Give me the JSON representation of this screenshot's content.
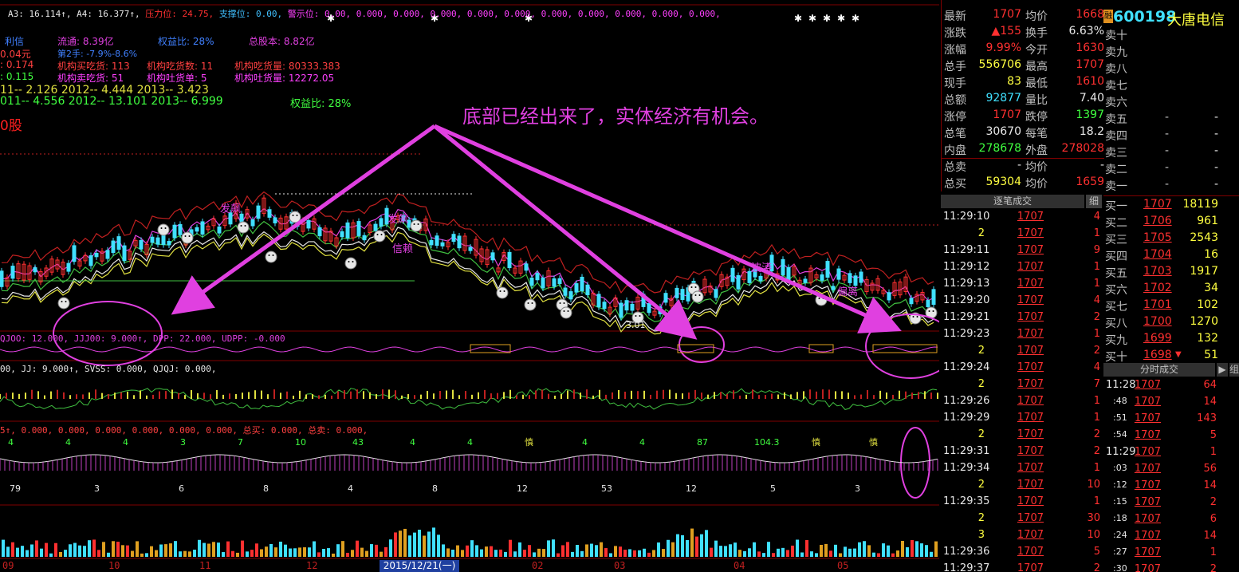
{
  "indicator_line": {
    "a3": "A3: 16.114↑, A4: 16.377↑,",
    "pressure": "压力位: 24.75,",
    "support": "支撑位: 0.00,",
    "warning": "警示位: 0.00, 0.000, 0.000, 0.000, 0.000, 0.000, 0.000, 0.000, 0.000, 0.000, 0.000,"
  },
  "fundamentals": {
    "row1": {
      "a": "利信",
      "b": "流通: 8.39亿",
      "c": "权益比: 28%",
      "d": "总股本: 8.82亿"
    },
    "row2": {
      "a": "0.04元",
      "b": "第2手: -7.9%-8.6%"
    },
    "row3": {
      "a": ": 0.174",
      "b": "机构买吃货: 113",
      "c": "机构吃货数: 11",
      "d": "机构吃货量: 80333.383"
    },
    "row4": {
      "a": ": 0.115",
      "b": "机构卖吃货: 51",
      "c": "机构吐货单: 5",
      "d": "机构吐货量: 12272.05"
    },
    "row5": "11-- 2.126   2012-- 4.444   2013-- 3.423",
    "row6": {
      "a": "011-- 4.556   2012-- 13.101   2013-- 6.999",
      "b": "权益比: 28%"
    },
    "row7": "0股"
  },
  "annotation": "底部已经出来了，实体经济有机会。",
  "candles_labels": {
    "l1": "发飙",
    "l2": "发飙",
    "l3": "信赖",
    "l4": "波涛",
    "l5": "偏离",
    "l6": "3.01"
  },
  "sub1_label": "QJOO: 12.000, JJJ00: 9.000↑, DPP: 22.000, UDPP: -0.000",
  "sub2_label": "00, JJ: 9.000↑, SVSS: 0.000, QJQJ: 0.000,",
  "sub3_label": "5↑, 0.000, 0.000, 0.000, 0.000, 0.000, 0.000, 总买: 0.000, 总卖: 0.000,",
  "sub3_marks": [
    "4",
    "4",
    "4",
    "3",
    "7",
    "10",
    "43",
    "4",
    "4",
    "慎",
    "4",
    "4",
    "87",
    "104.3",
    "慎",
    "慎"
  ],
  "sub3_bottom": [
    "79",
    "3",
    "6",
    "8",
    "4",
    "8",
    "12",
    "53",
    "12",
    "5",
    "3"
  ],
  "xaxis": {
    "labels": [
      "09",
      "10",
      "11",
      "12",
      "02",
      "03",
      "04",
      "05"
    ],
    "highlight_date": "2015/12/21(一)"
  },
  "quote": {
    "rows": [
      {
        "l1": "最新",
        "v1": "1707",
        "c1": "red",
        "l2": "均价",
        "v2": "1668",
        "c2": "red"
      },
      {
        "l1": "涨跌",
        "v1": "▲155",
        "c1": "red",
        "l2": "换手",
        "v2": "6.63%",
        "c2": "white"
      },
      {
        "l1": "涨幅",
        "v1": "9.99%",
        "c1": "red",
        "l2": "今开",
        "v2": "1630",
        "c2": "red"
      },
      {
        "l1": "总手",
        "v1": "556706",
        "c1": "yellow",
        "l2": "最高",
        "v2": "1707",
        "c2": "red"
      },
      {
        "l1": "现手",
        "v1": "83",
        "c1": "yellow",
        "l2": "最低",
        "v2": "1610",
        "c2": "red"
      },
      {
        "l1": "总额",
        "v1": "92877",
        "c1": "cyan",
        "l2": "量比",
        "v2": "7.40",
        "c2": "white"
      },
      {
        "l1": "涨停",
        "v1": "1707",
        "c1": "red",
        "l2": "跌停",
        "v2": "1397",
        "c2": "green"
      },
      {
        "l1": "总笔",
        "v1": "30670",
        "c1": "white",
        "l2": "每笔",
        "v2": "18.2",
        "c2": "white"
      },
      {
        "l1": "内盘",
        "v1": "278678",
        "c1": "green",
        "l2": "外盘",
        "v2": "278028",
        "c2": "red"
      },
      {
        "l1": "总卖",
        "v1": "-",
        "c1": "white",
        "l2": "均价",
        "v2": "-",
        "c2": "white"
      },
      {
        "l1": "总买",
        "v1": "59304",
        "c1": "yellow",
        "l2": "均价",
        "v2": "1659",
        "c2": "red"
      }
    ]
  },
  "stock": {
    "code": "600198",
    "name": "大唐电信",
    "badge": "融"
  },
  "order_book": {
    "sell": [
      {
        "label": "卖十",
        "price": "",
        "vol": ""
      },
      {
        "label": "卖九",
        "price": "",
        "vol": ""
      },
      {
        "label": "卖八",
        "price": "",
        "vol": ""
      },
      {
        "label": "卖七",
        "price": "",
        "vol": ""
      },
      {
        "label": "卖六",
        "price": "",
        "vol": ""
      },
      {
        "label": "卖五",
        "price": "-",
        "vol": "-"
      },
      {
        "label": "卖四",
        "price": "-",
        "vol": "-"
      },
      {
        "label": "卖三",
        "price": "-",
        "vol": "-"
      },
      {
        "label": "卖二",
        "price": "-",
        "vol": "-"
      },
      {
        "label": "卖一",
        "price": "-",
        "vol": "-"
      }
    ],
    "buy": [
      {
        "label": "买一",
        "price": "1707",
        "vol": "18119"
      },
      {
        "label": "买二",
        "price": "1706",
        "vol": "961"
      },
      {
        "label": "买三",
        "price": "1705",
        "vol": "2543"
      },
      {
        "label": "买四",
        "price": "1704",
        "vol": "16"
      },
      {
        "label": "买五",
        "price": "1703",
        "vol": "1917"
      },
      {
        "label": "买六",
        "price": "1702",
        "vol": "34"
      },
      {
        "label": "买七",
        "price": "1701",
        "vol": "102"
      },
      {
        "label": "买八",
        "price": "1700",
        "vol": "1270"
      },
      {
        "label": "买九",
        "price": "1699",
        "vol": "132"
      },
      {
        "label": "买十",
        "price": "1698",
        "vol": "51"
      }
    ]
  },
  "tick_panel": {
    "title": "逐笔成交",
    "corner": "细",
    "rows": [
      {
        "time": "11:29:10",
        "price": "1707",
        "vol": "4"
      },
      {
        "time": "2",
        "price": "1707",
        "vol": "1"
      },
      {
        "time": "11:29:11",
        "price": "1707",
        "vol": "9"
      },
      {
        "time": "11:29:12",
        "price": "1707",
        "vol": "1"
      },
      {
        "time": "11:29:13",
        "price": "1707",
        "vol": "1"
      },
      {
        "time": "11:29:20",
        "price": "1707",
        "vol": "4"
      },
      {
        "time": "11:29:21",
        "price": "1707",
        "vol": "2"
      },
      {
        "time": "11:29:23",
        "price": "1707",
        "vol": "1"
      },
      {
        "time": "2",
        "price": "1707",
        "vol": "2"
      },
      {
        "time": "11:29:24",
        "price": "1707",
        "vol": "4"
      },
      {
        "time": "2",
        "price": "1707",
        "vol": "7"
      },
      {
        "time": "11:29:26",
        "price": "1707",
        "vol": "1"
      },
      {
        "time": "11:29:29",
        "price": "1707",
        "vol": "1"
      },
      {
        "time": "2",
        "price": "1707",
        "vol": "2"
      },
      {
        "time": "11:29:31",
        "price": "1707",
        "vol": "2"
      },
      {
        "time": "11:29:34",
        "price": "1707",
        "vol": "1"
      },
      {
        "time": "2",
        "price": "1707",
        "vol": "10"
      },
      {
        "time": "11:29:35",
        "price": "1707",
        "vol": "1"
      },
      {
        "time": "2",
        "price": "1707",
        "vol": "30"
      },
      {
        "time": "3",
        "price": "1707",
        "vol": "10"
      },
      {
        "time": "11:29:36",
        "price": "1707",
        "vol": "5"
      },
      {
        "time": "11:29:37",
        "price": "1707",
        "vol": "2"
      }
    ]
  },
  "minute_panel": {
    "title": "分时成交",
    "corner": "组",
    "rows": [
      {
        "time": "11:28",
        "price": "1707",
        "vol": "64",
        "c": "green"
      },
      {
        "time": ":48",
        "price": "1707",
        "vol": "14",
        "c": "green"
      },
      {
        "time": ":51",
        "price": "1707",
        "vol": "143",
        "c": "green"
      },
      {
        "time": ":54",
        "price": "1707",
        "vol": "5",
        "c": "green"
      },
      {
        "time": "11:29",
        "price": "1707",
        "vol": "1",
        "c": "green"
      },
      {
        "time": ":03",
        "price": "1707",
        "vol": "56",
        "c": "green"
      },
      {
        "time": ":12",
        "price": "1707",
        "vol": "14",
        "c": "green"
      },
      {
        "time": ":15",
        "price": "1707",
        "vol": "2",
        "c": "green"
      },
      {
        "time": ":18",
        "price": "1707",
        "vol": "6",
        "c": "green"
      },
      {
        "time": ":24",
        "price": "1707",
        "vol": "14",
        "c": "green"
      },
      {
        "time": ":27",
        "price": "1707",
        "vol": "1",
        "c": "white"
      },
      {
        "time": ":30",
        "price": "1707",
        "vol": "2",
        "c": "white"
      }
    ]
  }
}
